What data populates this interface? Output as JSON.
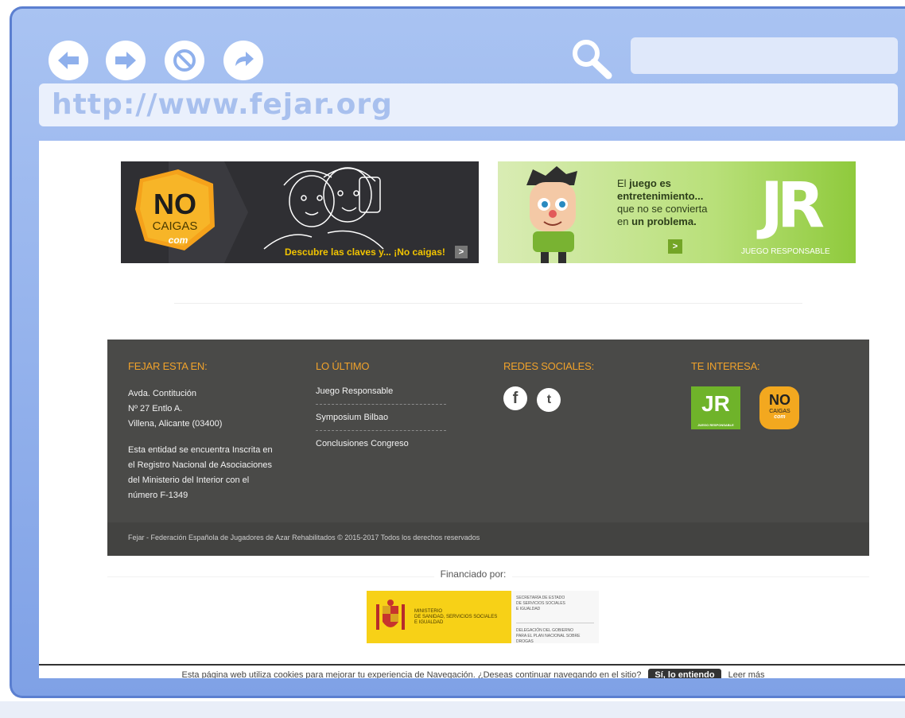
{
  "browser": {
    "url": "http://www.fejar.org",
    "colors": {
      "frame": "#8fb0ec",
      "button": "#ffffff",
      "icon": "#8fb0ec"
    },
    "nav_icons": [
      "back-arrow-icon",
      "forward-arrow-icon",
      "stop-icon",
      "refresh-icon"
    ],
    "search_icon": "magnifier-icon"
  },
  "banners": {
    "nocaigas": {
      "logo_top": "NO",
      "logo_bottom": "CAIGAS",
      "logo_tld": "com",
      "cta": "Descubre las claves y... ¡No caigas!",
      "arrow": ">"
    },
    "juego": {
      "line1": "El ",
      "line1_bold": "juego es",
      "line2": "entretenimiento...",
      "line3": "que no se convierta",
      "line4": "en ",
      "line4_bold": "un problema.",
      "arrow": ">",
      "logo": "JR",
      "logo_caption": "JUEGO RESPONSABLE"
    }
  },
  "footer": {
    "col1": {
      "heading": "FEJAR ESTA EN:",
      "address1": "Avda. Contitución",
      "address2": "Nº 27 Entlo A.",
      "address3": "Villena, Alicante (03400)",
      "note1": "Esta entidad se encuentra Inscrita en",
      "note2": "el Registro Nacional de Asociaciones",
      "note3": "del Ministerio del Interior con el",
      "note4": "número F-1349"
    },
    "col2": {
      "heading": "LO ÚLTIMO",
      "links": [
        "Juego Responsable",
        "Symposium Bilbao",
        "Conclusiones Congreso"
      ]
    },
    "col3": {
      "heading": "REDES SOCIALES:",
      "facebook": "f",
      "twitter": "t"
    },
    "col4": {
      "heading": "TE INTERESA:",
      "jr_logo": "JR",
      "jr_caption": "JUEGO RESPONSABLE",
      "nc_top": "NO",
      "nc_bottom": "CAIGAS",
      "nc_tld": "com"
    },
    "copyright": "Fejar - Federación Española de Jugadores de Azar Rehabilitados © 2015-2017 Todos los derechos reservados"
  },
  "funding": {
    "label": "Financiado por:",
    "ministry1": "MINISTERIO",
    "ministry2": "DE SANIDAD, SERVICIOS SOCIALES",
    "ministry3": "E IGUALDAD",
    "sec1": "SECRETARÍA DE ESTADO",
    "sec2": "DE SERVICIOS SOCIALES",
    "sec3": "E IGUALDAD",
    "del1": "DELEGACIÓN DEL GOBIERNO",
    "del2": "PARA EL PLAN NACIONAL SOBRE DROGAS"
  },
  "cookie_bar": {
    "text": "Esta página web utiliza cookies para mejorar tu experiencia de Navegación. ¿Deseas continuar navegando en el sitio?",
    "accept": "Sí, lo entiendo",
    "more": "Leer más"
  }
}
